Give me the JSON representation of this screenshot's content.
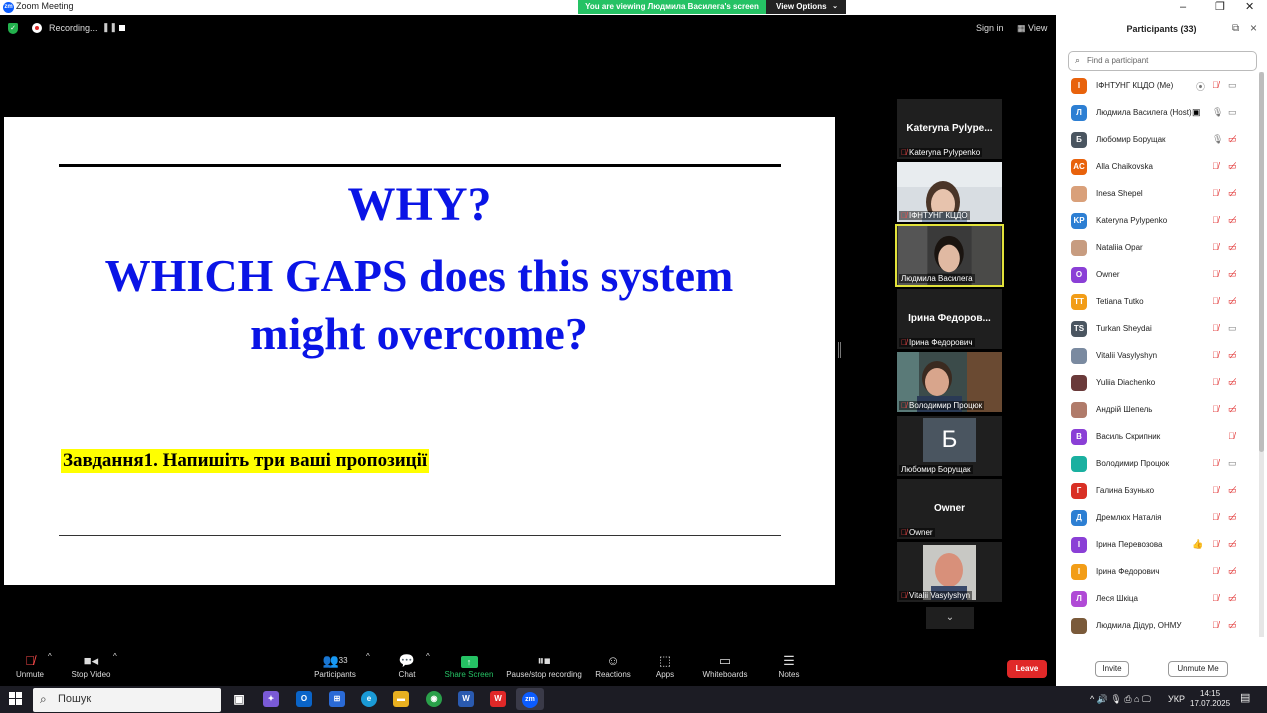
{
  "window": {
    "title": "Zoom Meeting",
    "controls": [
      "–",
      "❐",
      "✕"
    ]
  },
  "banner": {
    "viewing": "You are viewing Людмила Василега's screen",
    "view_options": "View Options"
  },
  "meeting_header": {
    "recording": "Recording...",
    "pause": "❚❚",
    "sign_in": "Sign in",
    "view": "View"
  },
  "slide": {
    "line1": "WHY?",
    "line2": "WHICH GAPS does this system might  overcome?",
    "task": "Завдання1. Напишіть три ваші  пропозиції"
  },
  "tiles": [
    {
      "name": "Kateryna  Pylype...",
      "label": "Kateryna Pylypenko",
      "muted": true
    },
    {
      "label": "ІФНТУНГ КЦДО",
      "muted": true
    },
    {
      "label": "Людмила Василега",
      "muted": false
    },
    {
      "name": "Ірина  Федоров...",
      "label": "Ірина Федорович",
      "muted": true
    },
    {
      "label": "Володимир Процюк",
      "muted": true
    },
    {
      "initial": "Б",
      "label": "Любомир Борущак",
      "muted": false
    },
    {
      "name": "Owner",
      "label": "Owner",
      "muted": true
    },
    {
      "label": "Vitalii Vasylyshyn",
      "muted": true
    }
  ],
  "toolbar": {
    "unmute": "Unmute",
    "stop_video": "Stop Video",
    "participants": "Participants",
    "participants_count": "33",
    "chat": "Chat",
    "share_screen": "Share Screen",
    "pause_recording": "Pause/stop recording",
    "reactions": "Reactions",
    "apps": "Apps",
    "whiteboards": "Whiteboards",
    "notes": "Notes",
    "leave": "Leave"
  },
  "panel": {
    "title": "Participants (33)",
    "search_placeholder": "Find a participant",
    "participants": [
      {
        "initials": "І",
        "color": "#e8620c",
        "name": "ІФНТУНГ КЦДО (Me)"
      },
      {
        "initials": "Л",
        "color": "#2d7fd3",
        "name": "Людмила Василега (Host)"
      },
      {
        "initials": "Б",
        "color": "#4a5560",
        "name": "Любомир Борущак"
      },
      {
        "initials": "AC",
        "color": "#e8620c",
        "name": "Alla Chaikovska"
      },
      {
        "initials": "",
        "color": "#d9a07a",
        "name": "Inesa Shepel"
      },
      {
        "initials": "KP",
        "color": "#2d7fd3",
        "name": "Kateryna Pylypenko"
      },
      {
        "initials": "",
        "color": "#c79c80",
        "name": "Nataliia Opar"
      },
      {
        "initials": "O",
        "color": "#8a3fd6",
        "name": "Owner"
      },
      {
        "initials": "TT",
        "color": "#f29d17",
        "name": "Tetiana Tutko"
      },
      {
        "initials": "TS",
        "color": "#4a5560",
        "name": "Turkan Sheydai"
      },
      {
        "initials": "",
        "color": "#7a8aa0",
        "name": "Vitalii Vasylyshyn"
      },
      {
        "initials": "",
        "color": "#6a3a3a",
        "name": "Yuliia Diachenko"
      },
      {
        "initials": "",
        "color": "#b07b6a",
        "name": "Андрій Шепель"
      },
      {
        "initials": "В",
        "color": "#8a3fd6",
        "name": "Василь Скрипник"
      },
      {
        "initials": "",
        "color": "#1ab0a0",
        "name": "Володимир Процюк"
      },
      {
        "initials": "Г",
        "color": "#d93025",
        "name": "Галина Бзунько"
      },
      {
        "initials": "Д",
        "color": "#2d7fd3",
        "name": "Дремлюх Наталія"
      },
      {
        "initials": "І",
        "color": "#8a3fd6",
        "name": "Ірина Перевозова"
      },
      {
        "initials": "І",
        "color": "#f29d17",
        "name": "Ірина Федорович"
      },
      {
        "initials": "Л",
        "color": "#b04ad6",
        "name": "Леся Шкіца"
      },
      {
        "initials": "",
        "color": "#7a5a3a",
        "name": "Людмила Дідур, ОНМУ"
      }
    ],
    "invite": "Invite",
    "unmute_me": "Unmute Me"
  },
  "taskbar": {
    "search": "Пошук",
    "lang": "УКР",
    "time": "14:15",
    "date": "17.07.2025"
  }
}
